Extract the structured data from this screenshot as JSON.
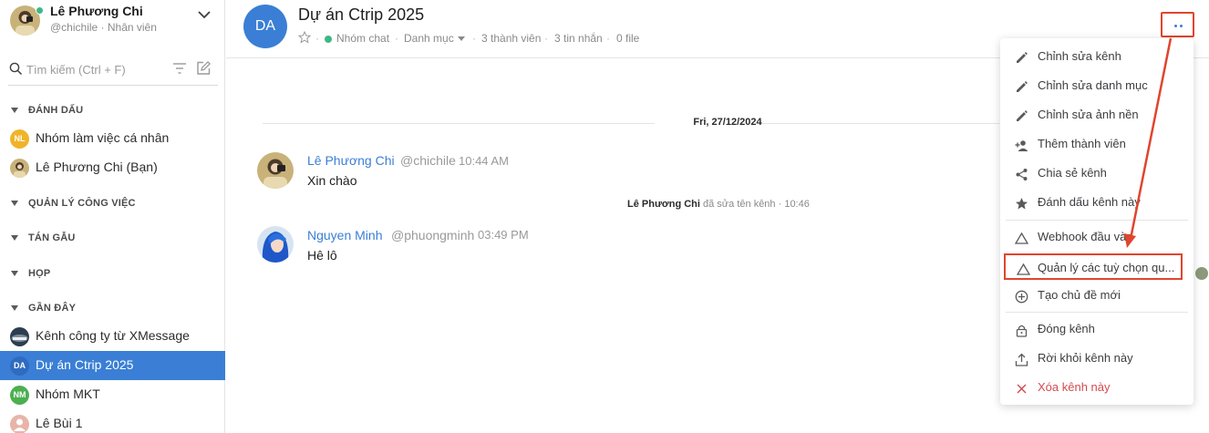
{
  "user": {
    "name": "Lê Phương Chi",
    "subtitle": "@chichile · Nhân viên"
  },
  "search": {
    "placeholder": "Tìm kiếm (Ctrl + F)"
  },
  "sidebar": {
    "sections": [
      {
        "label": "ĐÁNH DẤU"
      },
      {
        "label": "QUẢN LÝ CÔNG VIỆC"
      },
      {
        "label": "TÁN GẪU"
      },
      {
        "label": "HỌP"
      },
      {
        "label": "GẦN ĐÂY"
      }
    ],
    "favorites": [
      {
        "initials": "NL",
        "name": "Nhóm làm việc cá nhân",
        "color": "#f0b429"
      },
      {
        "initials": "",
        "name": "Lê Phương Chi (Bạn)",
        "color": "#6b8a4e"
      }
    ],
    "recent": [
      {
        "initials": "",
        "name": "Kênh công ty từ XMessage",
        "color": "#2c3e50"
      },
      {
        "initials": "DA",
        "name": "Dự án Ctrip 2025",
        "color": "#2f6bc0",
        "active": true
      },
      {
        "initials": "NM",
        "name": "Nhóm MKT",
        "color": "#4caf50"
      },
      {
        "initials": "",
        "name": "Lê Bùi 1",
        "color": "#e8b4a8"
      }
    ]
  },
  "channel": {
    "avatar_initials": "DA",
    "title": "Dự án Ctrip 2025",
    "type": "Nhóm chat",
    "category": "Danh mục",
    "members": "3 thành viên",
    "messages": "3 tin nhắn",
    "files": "0 file",
    "separator": "·"
  },
  "conversation": {
    "date": "Fri, 27/12/2024",
    "messages": [
      {
        "author": "Lê Phương Chi",
        "handle": "@chichile",
        "time": "10:44 AM",
        "text": "Xin chào"
      },
      {
        "author": "Nguyen Minh",
        "handle": "@phuongminh",
        "time": "03:49 PM",
        "text": "Hê lô"
      }
    ],
    "system": {
      "actor": "Lê Phương Chi",
      "action": "đã sửa tên kênh · 10:46"
    }
  },
  "menu": {
    "items": [
      {
        "label": "Chỉnh sửa kênh",
        "icon": "pencil-icon"
      },
      {
        "label": "Chỉnh sửa danh mục",
        "icon": "pencil-icon"
      },
      {
        "label": "Chỉnh sửa ảnh nền",
        "icon": "pencil-icon"
      },
      {
        "label": "Thêm thành viên",
        "icon": "add-person-icon"
      },
      {
        "label": "Chia sẻ kênh",
        "icon": "share-icon"
      },
      {
        "label": "Đánh dấu kênh này",
        "icon": "star-icon"
      },
      {
        "label": "Webhook đầu vào",
        "icon": "triangle-icon"
      },
      {
        "label": "Quản lý các tuỳ chọn qu...",
        "icon": "triangle-icon"
      },
      {
        "label": "Tạo chủ đề mới",
        "icon": "plus-circle-icon"
      },
      {
        "label": "Đóng kênh",
        "icon": "lock-icon"
      },
      {
        "label": "Rời khỏi kênh này",
        "icon": "leave-icon"
      },
      {
        "label": "Xóa kênh này",
        "icon": "close-icon"
      }
    ]
  },
  "colors": {
    "accent": "#3a7fd5",
    "highlight": "#e0452e",
    "danger": "#d24b4e",
    "online": "#3db887"
  }
}
